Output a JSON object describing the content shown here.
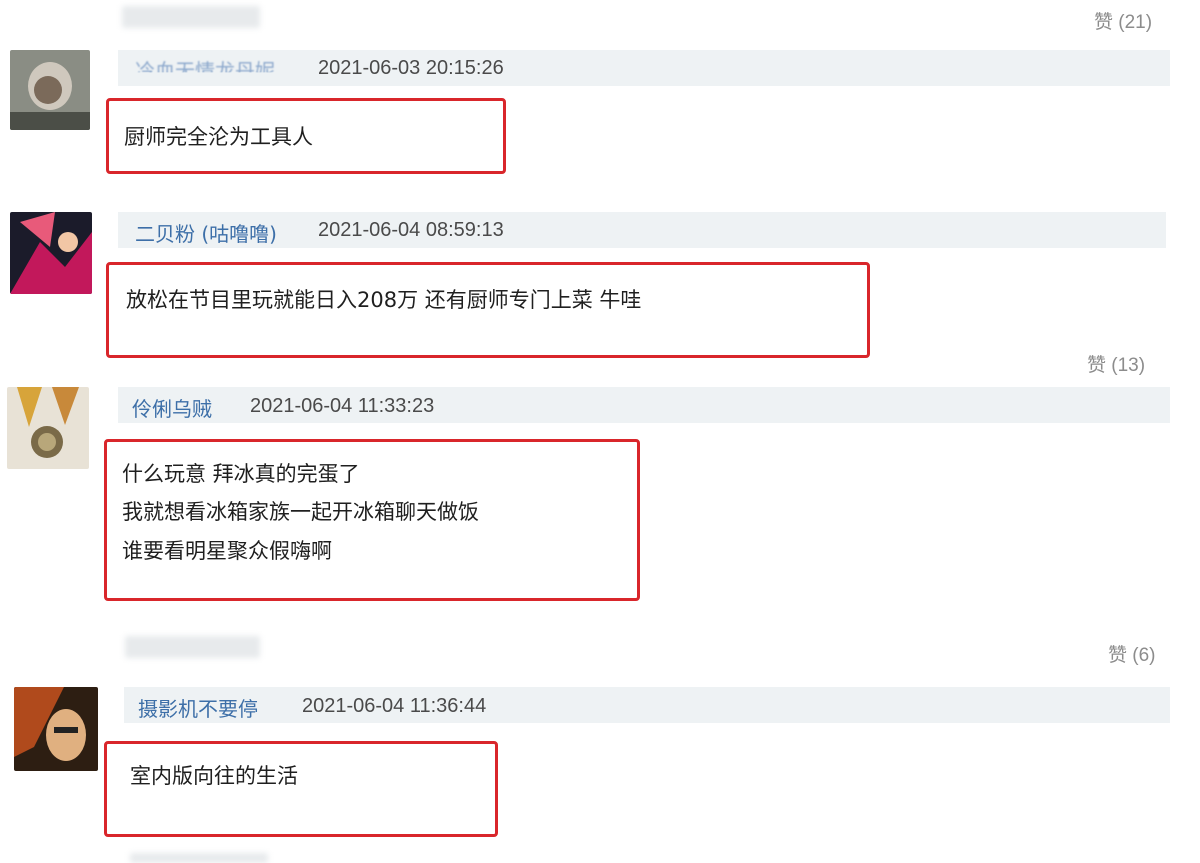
{
  "comments": [
    {
      "username": "冷血无情龙丹妮",
      "timestamp": "2021-06-03 20:15:26",
      "lines": [
        "厨师完全沦为工具人"
      ]
    },
    {
      "username": "二贝粉 (咕噜噜)",
      "timestamp": "2021-06-04 08:59:13",
      "lines": [
        "放松在节目里玩就能日入208万 还有厨师专门上菜 牛哇"
      ],
      "likes": "赞 (13)"
    },
    {
      "username": "伶俐乌贼",
      "timestamp": "2021-06-04 11:33:23",
      "lines": [
        "什么玩意 拜冰真的完蛋了",
        "我就想看冰箱家族一起开冰箱聊天做饭",
        "谁要看明星聚众假嗨啊"
      ]
    },
    {
      "username": "摄影机不要停",
      "timestamp": "2021-06-04 11:36:44",
      "lines": [
        "室内版向往的生活"
      ]
    }
  ],
  "top_likes": "赞 (21)",
  "mid_likes": "赞 (6)",
  "colors": {
    "highlight_border": "#d9262b",
    "username": "#3d6fa8",
    "header_bar": "#eef2f4"
  }
}
